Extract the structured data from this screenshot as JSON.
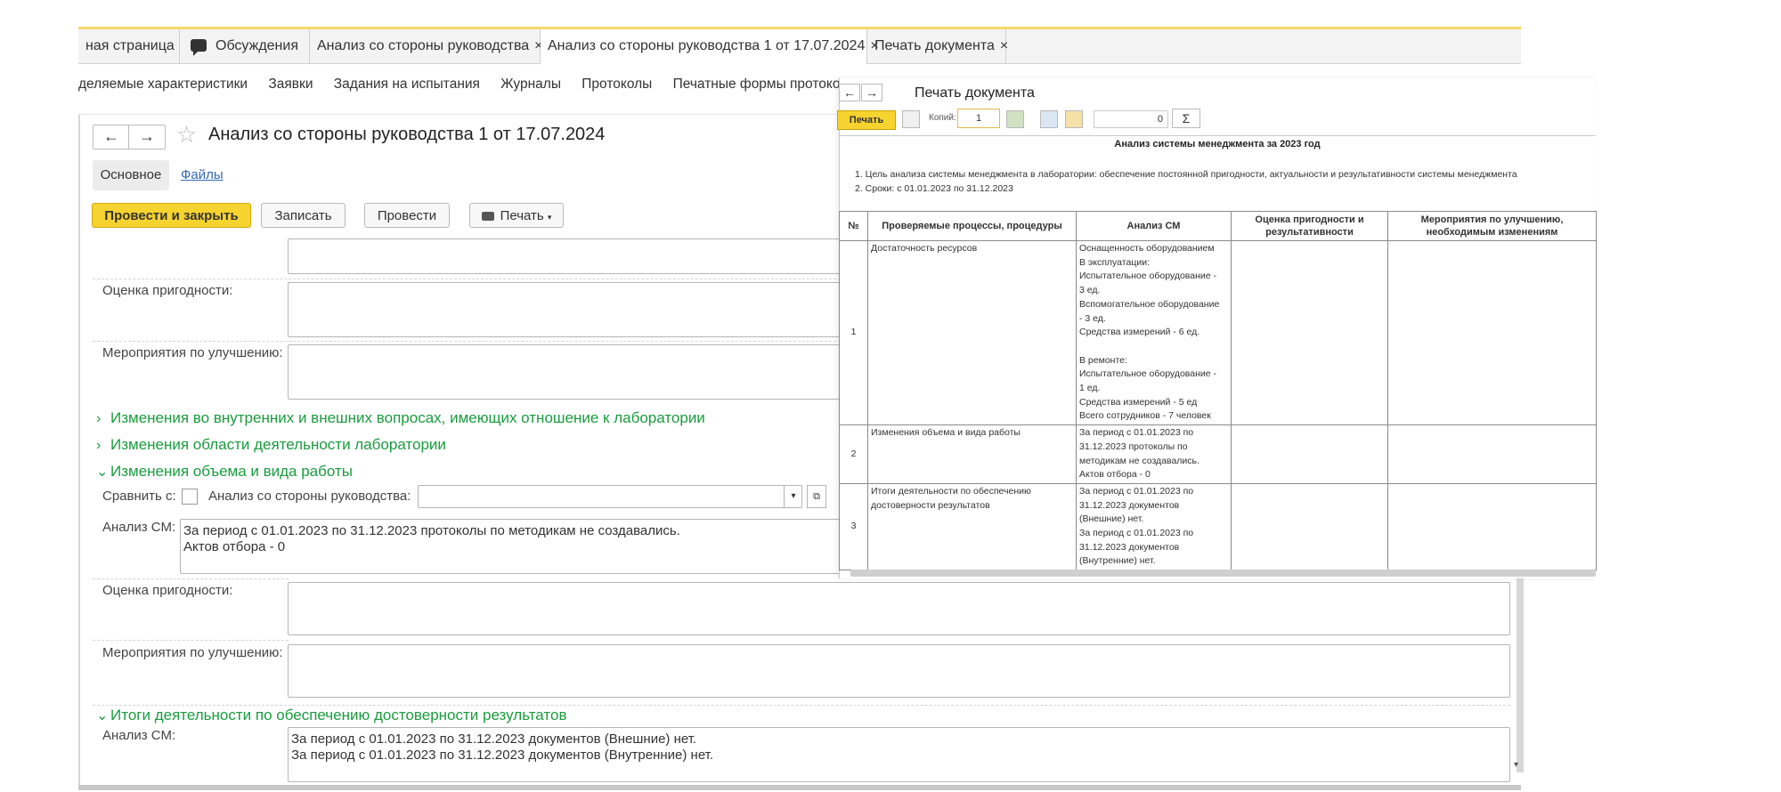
{
  "tabs": [
    {
      "label": "ная страница",
      "close": ""
    },
    {
      "label": "Обсуждения",
      "close": ""
    },
    {
      "label": "Анализ со стороны руководства",
      "close": "×"
    },
    {
      "label": "Анализ со стороны руководства 1 от 17.07.2024",
      "close": "×"
    },
    {
      "label": "Печать документа",
      "close": "×"
    }
  ],
  "nav": [
    "деляемые характеристики",
    "Заявки",
    "Задания на испытания",
    "Журналы",
    "Протоколы",
    "Печатные формы протоколов"
  ],
  "form": {
    "title": "Анализ со стороны руководства 1 от 17.07.2024",
    "back": "←",
    "forward": "→",
    "star": "☆",
    "subtabs": {
      "main": "Основное",
      "files": "Файлы"
    },
    "buttons": {
      "post_close": "Провести и закрыть",
      "save": "Записать",
      "post": "Провести",
      "print": "Печать"
    },
    "labels": {
      "suitability": "Оценка пригодности:",
      "improvement": "Мероприятия по улучшению:",
      "compare": "Сравнить с:",
      "compare_doc": "Анализ со стороны руководства:",
      "analysis": "Анализ СМ:"
    },
    "sections": [
      {
        "chev": ">",
        "title": "Изменения во внутренних и внешних вопросах, имеющих отношение к лаборатории"
      },
      {
        "chev": ">",
        "title": "Изменения области деятельности лаборатории"
      },
      {
        "chev": "v",
        "title": "Изменения объема и вида работы"
      },
      {
        "chev": "v",
        "title": "Итоги деятельности по обеспечению достоверности результатов"
      }
    ],
    "analysis_volume": "За период с 01.01.2023 по 31.12.2023 протоколы по методикам не создавались.\nАктов отбора - 0",
    "analysis_results": "За период с 01.01.2023 по 31.12.2023 документов (Внешние) нет.\nЗа период с 01.01.2023 по 31.12.2023 документов (Внутренние) нет."
  },
  "print_window": {
    "title": "Печать документа",
    "print_button": "Печать",
    "copies_label": "Копий:",
    "copies_value": "1",
    "sum_value": "0",
    "sigma": "Σ",
    "report": {
      "title": "Анализ системы менеджмента за 2023 год",
      "lines": [
        "1.  Цель анализа системы менеджмента в лаборатории: обеспечение постоянной пригодности, актуальности и результативности системы менеджмента",
        "2.  Сроки: с 01.01.2023 по 31.12.2023"
      ],
      "columns": [
        "№",
        "Проверяемые процессы, процедуры",
        "Анализ СМ",
        "Оценка пригодности и результативности",
        "Мероприятия по улучшению, необходимым изменениям"
      ],
      "rows": [
        {
          "num": "1",
          "process": "Достаточность ресурсов",
          "analysis": "Оснащенность оборудованием\nВ эксплуатации:\nИспытательное оборудование -\n3 ед.\nВспомогательное оборудование\n- 3 ед.\nСредства измерений - 6 ед.\n\nВ ремонте:\nИспытательное оборудование -\n1 ед.\nСредства измерений - 5 ед\nВсего сотрудников - 7 человек",
          "assessment": "",
          "measures": ""
        },
        {
          "num": "2",
          "process": "Изменения объема и вида работы",
          "analysis": "За период с 01.01.2023 по\n31.12.2023 протоколы по\nметодикам не создавались.\nАктов отбора - 0",
          "assessment": "",
          "measures": ""
        },
        {
          "num": "3",
          "process": "Итоги деятельности по обеспечению\nдостоверности результатов",
          "analysis": "За период с 01.01.2023 по\n31.12.2023 документов\n(Внешние) нет.\nЗа период с 01.01.2023 по\n31.12.2023 документов\n(Внутренние) нет.",
          "assessment": "",
          "measures": ""
        }
      ]
    }
  }
}
